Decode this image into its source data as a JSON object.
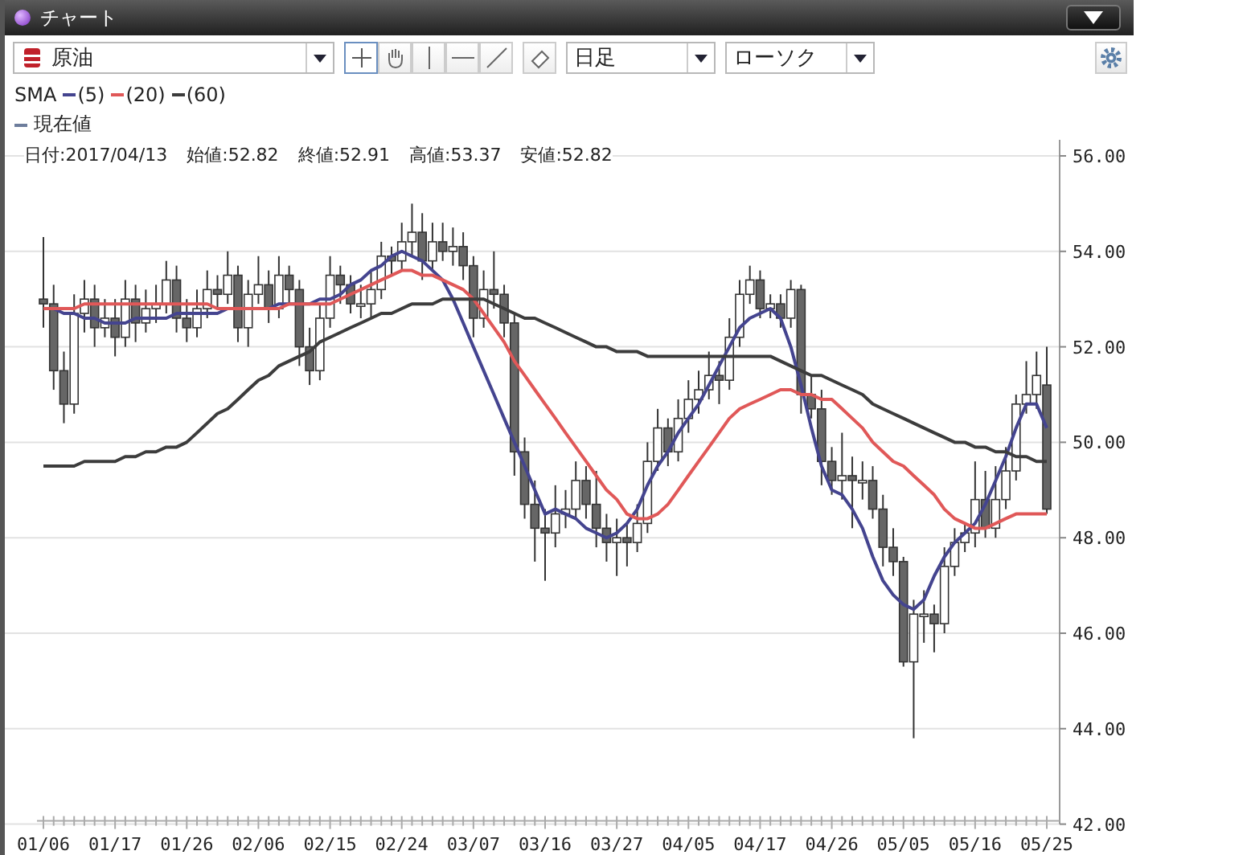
{
  "window": {
    "title": "チャート"
  },
  "toolbar": {
    "symbol": "原油",
    "tools": [
      {
        "kind": "crosshair",
        "selected": true
      },
      {
        "kind": "hand",
        "selected": false
      },
      {
        "kind": "vline",
        "selected": false
      },
      {
        "kind": "hline",
        "selected": false
      },
      {
        "kind": "trendline",
        "selected": false
      },
      {
        "kind": "eraser",
        "selected": false
      }
    ],
    "period": "日足",
    "chart_style": "ローソク"
  },
  "legend": {
    "indicator": "SMA",
    "current": {
      "label": "現在値",
      "color": "#6d7d9c"
    }
  },
  "info": [
    "日付:2017/04/13",
    "始値:52.82",
    "終値:52.91",
    "高値:53.37",
    "安値:52.82"
  ],
  "chart": {
    "chart_data": {
      "type": "candlestick",
      "grid": true,
      "categories": [
        "01/06",
        null,
        null,
        null,
        null,
        null,
        null,
        "01/17",
        null,
        null,
        null,
        null,
        null,
        null,
        "01/26",
        null,
        null,
        null,
        null,
        null,
        null,
        "02/06",
        null,
        null,
        null,
        null,
        null,
        null,
        "02/15",
        null,
        null,
        null,
        null,
        null,
        null,
        "02/24",
        null,
        null,
        null,
        null,
        null,
        null,
        "03/07",
        null,
        null,
        null,
        null,
        null,
        null,
        "03/16",
        null,
        null,
        null,
        null,
        null,
        null,
        "03/27",
        null,
        null,
        null,
        null,
        null,
        null,
        "04/05",
        null,
        null,
        null,
        null,
        null,
        null,
        "04/17",
        null,
        null,
        null,
        null,
        null,
        null,
        "04/26",
        null,
        null,
        null,
        null,
        null,
        null,
        "05/05",
        null,
        null,
        null,
        null,
        null,
        null,
        "05/16",
        null,
        null,
        null,
        null,
        null,
        null,
        "05/25"
      ],
      "ohlc": [
        [
          53.0,
          54.3,
          52.4,
          52.9
        ],
        [
          52.9,
          53.3,
          51.1,
          51.5
        ],
        [
          51.5,
          51.9,
          50.4,
          50.8
        ],
        [
          50.8,
          53.1,
          50.6,
          52.7
        ],
        [
          52.7,
          53.4,
          52.3,
          53.0
        ],
        [
          53.0,
          53.3,
          52.0,
          52.4
        ],
        [
          52.4,
          53.0,
          52.2,
          52.6
        ],
        [
          52.6,
          53.0,
          51.8,
          52.2
        ],
        [
          52.2,
          53.4,
          52.0,
          53.0
        ],
        [
          53.0,
          53.3,
          52.1,
          52.5
        ],
        [
          52.5,
          53.2,
          52.3,
          52.8
        ],
        [
          52.8,
          53.3,
          52.5,
          52.9
        ],
        [
          52.9,
          53.8,
          52.7,
          53.4
        ],
        [
          53.4,
          53.7,
          52.3,
          52.6
        ],
        [
          52.6,
          53.0,
          52.1,
          52.4
        ],
        [
          52.4,
          53.2,
          52.2,
          52.8
        ],
        [
          52.8,
          53.6,
          52.6,
          53.2
        ],
        [
          53.2,
          53.5,
          52.8,
          53.1
        ],
        [
          53.1,
          54.0,
          52.9,
          53.5
        ],
        [
          53.5,
          53.7,
          52.1,
          52.4
        ],
        [
          52.4,
          53.4,
          52.0,
          53.1
        ],
        [
          53.1,
          53.9,
          52.9,
          53.3
        ],
        [
          53.3,
          53.6,
          52.5,
          52.8
        ],
        [
          52.8,
          53.9,
          52.6,
          53.5
        ],
        [
          53.5,
          53.7,
          52.9,
          53.2
        ],
        [
          53.2,
          53.4,
          51.6,
          52.0
        ],
        [
          52.0,
          52.4,
          51.2,
          51.5
        ],
        [
          51.5,
          52.9,
          51.3,
          52.6
        ],
        [
          52.6,
          53.9,
          52.4,
          53.5
        ],
        [
          53.5,
          53.7,
          52.9,
          53.3
        ],
        [
          53.3,
          53.5,
          52.7,
          52.9
        ],
        [
          52.9,
          53.3,
          52.6,
          52.9
        ],
        [
          52.9,
          53.6,
          52.6,
          53.2
        ],
        [
          53.2,
          54.2,
          53.0,
          53.9
        ],
        [
          53.9,
          54.1,
          53.5,
          53.8
        ],
        [
          53.8,
          54.6,
          53.6,
          54.2
        ],
        [
          54.2,
          55.0,
          53.9,
          54.4
        ],
        [
          54.4,
          54.8,
          53.4,
          53.8
        ],
        [
          53.8,
          54.6,
          53.6,
          54.2
        ],
        [
          54.2,
          54.6,
          53.8,
          54.0
        ],
        [
          54.0,
          54.5,
          53.7,
          54.1
        ],
        [
          54.1,
          54.4,
          53.4,
          53.7
        ],
        [
          53.7,
          53.9,
          52.2,
          52.6
        ],
        [
          52.6,
          53.6,
          52.4,
          53.2
        ],
        [
          53.2,
          54.0,
          52.8,
          53.1
        ],
        [
          53.1,
          53.3,
          52.2,
          52.5
        ],
        [
          52.5,
          52.7,
          49.3,
          49.8
        ],
        [
          49.8,
          50.1,
          48.4,
          48.7
        ],
        [
          48.7,
          49.2,
          47.5,
          48.2
        ],
        [
          48.2,
          48.6,
          47.1,
          48.1
        ],
        [
          48.1,
          49.1,
          47.8,
          48.5
        ],
        [
          48.5,
          49.0,
          48.2,
          48.6
        ],
        [
          48.6,
          49.6,
          48.4,
          49.2
        ],
        [
          49.2,
          49.5,
          48.4,
          48.7
        ],
        [
          48.7,
          49.4,
          47.8,
          48.2
        ],
        [
          48.2,
          48.5,
          47.5,
          47.9
        ],
        [
          47.9,
          48.4,
          47.2,
          48.0
        ],
        [
          48.0,
          48.3,
          47.4,
          47.9
        ],
        [
          47.9,
          48.7,
          47.7,
          48.3
        ],
        [
          48.3,
          50.0,
          48.1,
          49.6
        ],
        [
          49.6,
          50.7,
          49.4,
          50.3
        ],
        [
          50.3,
          50.5,
          49.5,
          49.8
        ],
        [
          49.8,
          50.9,
          49.6,
          50.5
        ],
        [
          50.5,
          51.3,
          50.2,
          50.9
        ],
        [
          50.9,
          51.5,
          50.6,
          51.1
        ],
        [
          51.1,
          51.9,
          50.9,
          51.4
        ],
        [
          51.4,
          51.7,
          50.8,
          51.3
        ],
        [
          51.3,
          52.6,
          51.1,
          52.2
        ],
        [
          52.2,
          53.4,
          52.0,
          53.1
        ],
        [
          53.1,
          53.7,
          52.9,
          53.4
        ],
        [
          53.4,
          53.6,
          52.6,
          52.8
        ],
        [
          52.8,
          53.1,
          52.6,
          52.9
        ],
        [
          52.9,
          53.1,
          52.4,
          52.6
        ],
        [
          52.6,
          53.4,
          52.4,
          53.2
        ],
        [
          53.2,
          53.3,
          50.6,
          51.0
        ],
        [
          51.0,
          51.4,
          50.5,
          50.7
        ],
        [
          50.7,
          51.1,
          49.1,
          49.6
        ],
        [
          49.6,
          49.9,
          48.9,
          49.2
        ],
        [
          49.2,
          50.2,
          48.8,
          49.3
        ],
        [
          49.3,
          49.7,
          48.2,
          49.2
        ],
        [
          49.2,
          49.6,
          48.8,
          49.2
        ],
        [
          49.2,
          49.5,
          48.4,
          48.6
        ],
        [
          48.6,
          48.9,
          47.4,
          47.8
        ],
        [
          47.8,
          48.2,
          47.2,
          47.5
        ],
        [
          47.5,
          47.6,
          45.3,
          45.4
        ],
        [
          45.4,
          46.7,
          43.8,
          46.4
        ],
        [
          46.4,
          46.9,
          45.8,
          46.4
        ],
        [
          46.4,
          46.6,
          45.6,
          46.2
        ],
        [
          46.2,
          47.8,
          46.0,
          47.4
        ],
        [
          47.4,
          48.2,
          47.2,
          47.9
        ],
        [
          47.9,
          48.3,
          47.7,
          48.1
        ],
        [
          48.1,
          49.6,
          47.8,
          48.8
        ],
        [
          48.8,
          49.4,
          48.0,
          48.2
        ],
        [
          48.2,
          49.5,
          48.0,
          48.8
        ],
        [
          48.8,
          49.9,
          48.6,
          49.4
        ],
        [
          49.4,
          51.0,
          49.2,
          50.8
        ],
        [
          50.8,
          51.7,
          50.6,
          51.0
        ],
        [
          51.0,
          51.9,
          50.7,
          51.4
        ],
        [
          51.2,
          52.0,
          48.5,
          48.6
        ]
      ],
      "ylim": [
        42,
        56
      ],
      "yticks": [
        {
          "value": 42,
          "label": "42.00"
        },
        {
          "value": 44,
          "label": "44.00"
        },
        {
          "value": 46,
          "label": "46.00"
        },
        {
          "value": 48,
          "label": "48.00"
        },
        {
          "value": 50,
          "label": "50.00"
        },
        {
          "value": 52,
          "label": "52.00"
        },
        {
          "value": 54,
          "label": "54.00"
        },
        {
          "value": 56,
          "label": "56.00"
        }
      ]
    }
  },
  "moving_averages": {
    "chart_data": {
      "type": "line",
      "series": [
        {
          "name": "(5)",
          "color": "#44448f",
          "values": [
            52.8,
            52.8,
            52.7,
            52.7,
            52.6,
            52.6,
            52.5,
            52.5,
            52.5,
            52.6,
            52.6,
            52.6,
            52.6,
            52.7,
            52.7,
            52.7,
            52.7,
            52.7,
            52.8,
            52.8,
            52.8,
            52.8,
            52.8,
            52.9,
            52.9,
            52.9,
            52.9,
            53.0,
            53.0,
            53.1,
            53.3,
            53.4,
            53.6,
            53.7,
            53.9,
            54.0,
            53.9,
            53.8,
            53.6,
            53.4,
            53.0,
            52.5,
            52.0,
            51.5,
            51.0,
            50.5,
            50.0,
            49.5,
            49.0,
            48.5,
            48.6,
            48.5,
            48.4,
            48.2,
            48.1,
            48.0,
            48.1,
            48.3,
            48.6,
            49.1,
            49.5,
            49.8,
            50.2,
            50.5,
            50.8,
            51.2,
            51.6,
            52.0,
            52.4,
            52.6,
            52.7,
            52.8,
            52.6,
            52.0,
            51.2,
            50.3,
            49.5,
            49.0,
            48.9,
            48.6,
            48.2,
            47.6,
            47.1,
            46.8,
            46.6,
            46.5,
            46.7,
            47.2,
            47.6,
            47.9,
            48.1,
            48.3,
            48.7,
            49.2,
            49.7,
            50.3,
            50.8,
            50.8,
            50.3
          ]
        },
        {
          "name": "(20)",
          "color": "#e05858",
          "values": [
            52.8,
            52.8,
            52.8,
            52.8,
            52.9,
            52.9,
            52.9,
            52.9,
            52.9,
            52.9,
            52.9,
            52.9,
            52.9,
            52.9,
            52.9,
            52.9,
            52.9,
            52.8,
            52.8,
            52.8,
            52.8,
            52.8,
            52.8,
            52.8,
            52.9,
            52.9,
            52.9,
            52.9,
            52.9,
            53.0,
            53.1,
            53.2,
            53.3,
            53.4,
            53.5,
            53.6,
            53.6,
            53.5,
            53.5,
            53.4,
            53.3,
            53.2,
            53.0,
            52.7,
            52.4,
            52.1,
            51.7,
            51.4,
            51.1,
            50.8,
            50.5,
            50.2,
            49.9,
            49.6,
            49.3,
            49.0,
            48.8,
            48.5,
            48.4,
            48.4,
            48.5,
            48.7,
            49.0,
            49.3,
            49.6,
            49.9,
            50.2,
            50.5,
            50.7,
            50.8,
            50.9,
            51.0,
            51.1,
            51.1,
            51.0,
            51.0,
            50.9,
            50.9,
            50.7,
            50.5,
            50.3,
            50.0,
            49.8,
            49.6,
            49.5,
            49.3,
            49.1,
            48.9,
            48.6,
            48.4,
            48.3,
            48.2,
            48.2,
            48.3,
            48.4,
            48.5,
            48.5,
            48.5,
            48.5
          ]
        },
        {
          "name": "(60)",
          "color": "#3c3c3c",
          "values": [
            49.5,
            49.5,
            49.5,
            49.5,
            49.6,
            49.6,
            49.6,
            49.6,
            49.7,
            49.7,
            49.8,
            49.8,
            49.9,
            49.9,
            50.0,
            50.2,
            50.4,
            50.6,
            50.7,
            50.9,
            51.1,
            51.3,
            51.4,
            51.6,
            51.7,
            51.8,
            51.9,
            52.1,
            52.2,
            52.3,
            52.4,
            52.5,
            52.6,
            52.7,
            52.7,
            52.8,
            52.9,
            52.9,
            52.9,
            53.0,
            53.0,
            53.0,
            53.0,
            53.0,
            52.9,
            52.8,
            52.7,
            52.6,
            52.6,
            52.5,
            52.4,
            52.3,
            52.2,
            52.1,
            52.0,
            52.0,
            51.9,
            51.9,
            51.9,
            51.8,
            51.8,
            51.8,
            51.8,
            51.8,
            51.8,
            51.8,
            51.8,
            51.8,
            51.8,
            51.8,
            51.8,
            51.8,
            51.7,
            51.6,
            51.5,
            51.4,
            51.4,
            51.3,
            51.2,
            51.1,
            51.0,
            50.8,
            50.7,
            50.6,
            50.5,
            50.4,
            50.3,
            50.2,
            50.1,
            50.0,
            50.0,
            49.9,
            49.9,
            49.8,
            49.8,
            49.7,
            49.7,
            49.6,
            49.6
          ]
        }
      ],
      "ylim": [
        42,
        56
      ]
    }
  }
}
